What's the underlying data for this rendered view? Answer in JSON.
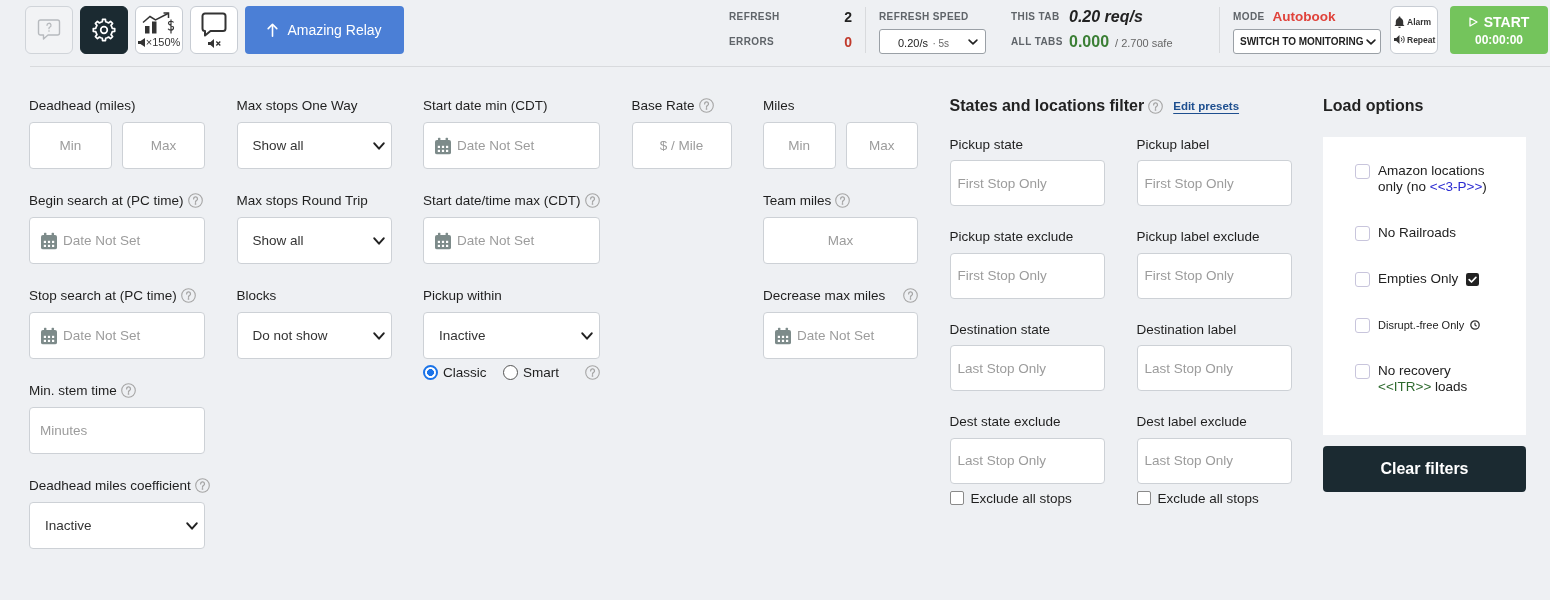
{
  "toolbar": {
    "icon_buttons": [
      {
        "kind": "help",
        "disabled": true,
        "active": false
      },
      {
        "kind": "settings",
        "disabled": false,
        "active": true
      },
      {
        "kind": "stats",
        "disabled": false,
        "active": false,
        "caption": "×150%"
      },
      {
        "kind": "chat",
        "disabled": false,
        "active": false
      }
    ],
    "relay_button": {
      "label": "Amazing Relay"
    }
  },
  "status": {
    "counters": [
      {
        "kind": "refresh",
        "label": "REFRESH",
        "value": "2"
      },
      {
        "kind": "errors",
        "label": "ERRORS",
        "value": "0"
      }
    ],
    "refresh_speed": {
      "label": "REFRESH SPEED",
      "value": "0.20/s",
      "detail": "· 5s"
    },
    "rates": [
      {
        "kind": "this_tab",
        "label": "THIS TAB",
        "value": "0.20 req/s"
      },
      {
        "kind": "all_tabs",
        "label": "ALL TABS",
        "value": "0.000",
        "note": "/ 2.700 safe"
      }
    ],
    "mode": {
      "label": "MODE",
      "value": "Autobook",
      "switch": "SWITCH TO MONITORING"
    },
    "alarm_button": {
      "alarm": "Alarm",
      "repeat": "Repeat"
    },
    "start_button": {
      "label": "START",
      "timer": "00:00:00"
    }
  },
  "filters": {
    "columns": [
      {
        "fields": [
          {
            "kind": "range",
            "label": "Deadhead (miles)",
            "inputs": [
              {
                "placeholder": "Min"
              },
              {
                "placeholder": "Max"
              }
            ]
          },
          {
            "kind": "date",
            "label": "Begin search at (PC time)",
            "help": true,
            "placeholder": "Date Not Set"
          },
          {
            "kind": "date",
            "label": "Stop search at (PC time)",
            "help": true,
            "placeholder": "Date Not Set"
          },
          {
            "kind": "text",
            "label": "Min. stem time",
            "help": true,
            "placeholder": "Minutes"
          },
          {
            "kind": "select",
            "label": "Deadhead miles coefficient",
            "help": true,
            "value": "Inactive"
          }
        ]
      },
      {
        "fields": [
          {
            "kind": "select",
            "label": "Max stops One Way",
            "value": "Show all"
          },
          {
            "kind": "select",
            "label": "Max stops Round Trip",
            "value": "Show all"
          },
          {
            "kind": "select",
            "label": "Blocks",
            "value": "Do not show"
          }
        ]
      },
      {
        "fields": [
          {
            "kind": "date",
            "label": "Start date min (CDT)",
            "placeholder": "Date Not Set"
          },
          {
            "kind": "date",
            "label": "Start date/time max (CDT)",
            "help": true,
            "placeholder": "Date Not Set"
          },
          {
            "kind": "select",
            "label": "Pickup within",
            "value": "Inactive",
            "radios": {
              "help": true,
              "options": [
                {
                  "label": "Classic",
                  "selected": true
                },
                {
                  "label": "Smart",
                  "selected": false
                }
              ]
            }
          }
        ]
      },
      {
        "fields": [
          {
            "kind": "number",
            "label": "Base Rate",
            "help": true,
            "placeholder": "$ / Mile"
          }
        ]
      },
      {
        "fields": [
          {
            "kind": "range",
            "label": "Miles",
            "inputs": [
              {
                "placeholder": "Min"
              },
              {
                "placeholder": "Max"
              }
            ]
          },
          {
            "kind": "number",
            "label": "Team miles",
            "help": true,
            "placeholder": "Max"
          },
          {
            "kind": "date",
            "label": "Decrease max miles",
            "help": true,
            "placeholder": "Date Not Set"
          }
        ]
      }
    ]
  },
  "states_filter": {
    "title": "States and locations filter",
    "help": true,
    "link": "Edit presets",
    "fields": [
      {
        "label": "Pickup state",
        "placeholder": "First Stop Only"
      },
      {
        "label": "Pickup label",
        "placeholder": "First Stop Only"
      },
      {
        "label": "Pickup state exclude",
        "placeholder": "First Stop Only"
      },
      {
        "label": "Pickup label exclude",
        "placeholder": "First Stop Only"
      },
      {
        "label": "Destination state",
        "placeholder": "Last Stop Only"
      },
      {
        "label": "Destination label",
        "placeholder": "Last Stop Only"
      },
      {
        "label": "Dest state exclude",
        "placeholder": "Last Stop Only"
      },
      {
        "label": "Dest label exclude",
        "placeholder": "Last Stop Only"
      }
    ],
    "exclude_all": [
      {
        "label": "Exclude all stops",
        "checked": false
      },
      {
        "label": "Exclude all stops",
        "checked": false
      }
    ]
  },
  "load_options": {
    "title": "Load options",
    "options": [
      {
        "kind": "plain",
        "checked": false,
        "parts": [
          {
            "text": "Amazon locations only (no "
          },
          {
            "text": "<<3-P>>",
            "color": "#2b2bd1"
          },
          {
            "text": ")"
          }
        ]
      },
      {
        "kind": "plain",
        "checked": false,
        "parts": [
          {
            "text": "No Railroads"
          }
        ]
      },
      {
        "kind": "boxed",
        "checked": false,
        "parts": [
          {
            "text": "Empties Only"
          }
        ]
      },
      {
        "kind": "compact",
        "checked": false,
        "parts": [
          {
            "text": "Disrupt.-free Only"
          }
        ]
      },
      {
        "kind": "plain",
        "checked": false,
        "parts": [
          {
            "text": "No recovery "
          },
          {
            "text": "<<ITR>>",
            "color": "#2e6a2e"
          },
          {
            "text": " loads"
          }
        ]
      }
    ],
    "clear_button": "Clear filters"
  }
}
